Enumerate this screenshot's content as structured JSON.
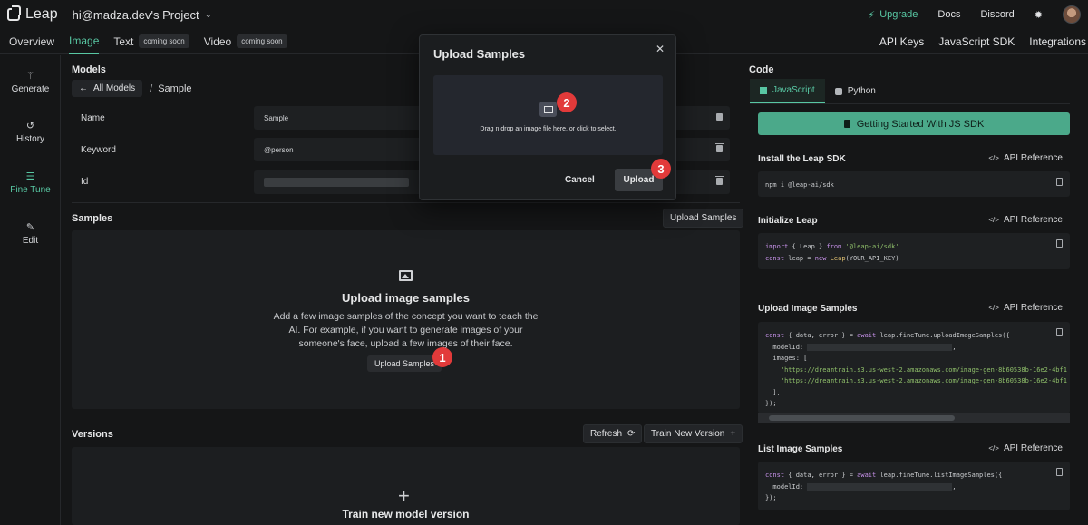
{
  "header": {
    "logo_text": "Leap",
    "project": "hi@madza.dev's Project",
    "upgrade": "Upgrade",
    "docs": "Docs",
    "discord": "Discord",
    "theme_icon": "sun-icon"
  },
  "tabs": {
    "overview": "Overview",
    "image": "Image",
    "text": "Text",
    "text_badge": "coming soon",
    "video": "Video",
    "video_badge": "coming soon",
    "api_keys": "API Keys",
    "js_sdk": "JavaScript SDK",
    "integrations": "Integrations"
  },
  "nav": {
    "generate": "Generate",
    "history": "History",
    "fine_tune": "Fine Tune",
    "edit": "Edit"
  },
  "models": {
    "title": "Models",
    "back": "All Models",
    "sep": "/",
    "current": "Sample",
    "fields": [
      {
        "label": "Name",
        "value": "Sample"
      },
      {
        "label": "Keyword",
        "value": "@person"
      },
      {
        "label": "Id",
        "value": ""
      }
    ]
  },
  "samples": {
    "title": "Samples",
    "upload_btn": "Upload Samples",
    "empty_title": "Upload image samples",
    "empty_desc": "Add a few image samples of the concept you want to teach the AI. For example, if you want to generate images of your someone's face, upload a few images of their face.",
    "empty_btn": "Upload Samples"
  },
  "versions": {
    "title": "Versions",
    "refresh": "Refresh",
    "train_new": "Train New Version",
    "empty_title": "Train new model version"
  },
  "code": {
    "title": "Code",
    "tab_js": "JavaScript",
    "tab_py": "Python",
    "start_btn": "Getting Started With JS SDK",
    "api_ref": "API Reference",
    "install_title": "Install the Leap SDK",
    "install_code": "npm i @leap-ai/sdk",
    "init_title": "Initialize Leap",
    "upload_title": "Upload Image Samples",
    "list_title": "List Image Samples"
  },
  "modal": {
    "title": "Upload Samples",
    "drop_text": "Drag n drop an image file here, or click to select.",
    "cancel": "Cancel",
    "upload": "Upload"
  },
  "annotations": {
    "b1": "1",
    "b2": "2",
    "b3": "3"
  },
  "colors": {
    "accent": "#58c7a3",
    "badge": "#e23a3a"
  }
}
